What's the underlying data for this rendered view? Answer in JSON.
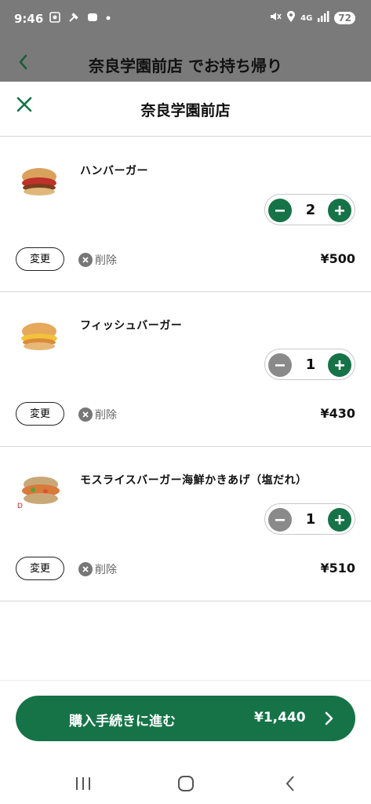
{
  "status_bar": {
    "time": "9:46",
    "network": "4G",
    "battery": "72"
  },
  "background_header": {
    "title": "奈良学園前店 でお持ち帰り"
  },
  "sheet": {
    "title": "奈良学園前店"
  },
  "items": [
    {
      "name": "ハンバーガー",
      "quantity": "2",
      "price": "¥500",
      "change_label": "変更",
      "delete_label": "削除"
    },
    {
      "name": "フィッシュバーガー",
      "quantity": "1",
      "price": "¥430",
      "change_label": "変更",
      "delete_label": "削除"
    },
    {
      "name": "モスライスバーガー海鮮かきあげ（塩だれ）",
      "quantity": "1",
      "price": "¥510",
      "change_label": "変更",
      "delete_label": "削除"
    }
  ],
  "checkout": {
    "label": "購入手続きに進む",
    "total": "¥1,440"
  },
  "colors": {
    "accent": "#157347",
    "disabled": "#8a8a8a"
  },
  "icons": {
    "close": "close-icon",
    "back": "chevron-left-icon",
    "minus": "minus-icon",
    "plus": "plus-icon",
    "delete": "x-circle-icon",
    "next": "chevron-right-icon"
  }
}
